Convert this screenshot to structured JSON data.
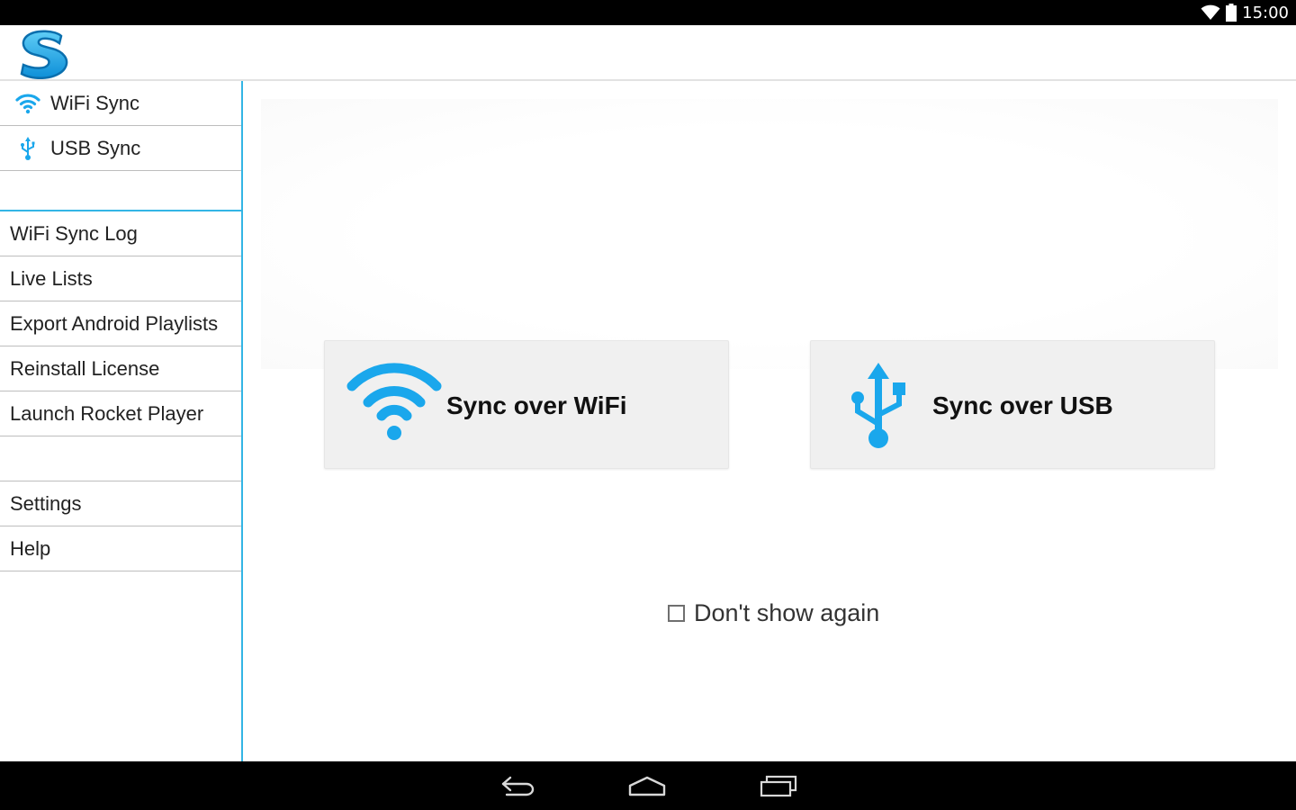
{
  "status_bar": {
    "time": "15:00",
    "wifi_icon": "wifi-icon",
    "battery_icon": "battery-icon"
  },
  "action_bar": {
    "logo_icon": "app-logo-s-icon"
  },
  "sidebar": {
    "primary_items": [
      {
        "label": "WiFi Sync",
        "icon": "wifi-icon"
      },
      {
        "label": "USB Sync",
        "icon": "usb-icon"
      }
    ],
    "secondary_items_1": [
      "WiFi Sync Log",
      "Live Lists",
      "Export Android Playlists",
      "Reinstall License",
      "Launch Rocket Player"
    ],
    "secondary_items_2": [
      "Settings",
      "Help"
    ]
  },
  "main": {
    "wifi_card": {
      "label": "Sync over WiFi",
      "icon": "wifi-icon"
    },
    "usb_card": {
      "label": "Sync over USB",
      "icon": "usb-icon"
    },
    "dont_show": {
      "label": "Don't show again",
      "checked": false
    }
  },
  "colors": {
    "accent": "#33b5e5",
    "icon_blue": "#1aa7ec"
  },
  "nav_bar": {
    "icons": [
      "back-icon",
      "home-icon",
      "recents-icon"
    ]
  }
}
